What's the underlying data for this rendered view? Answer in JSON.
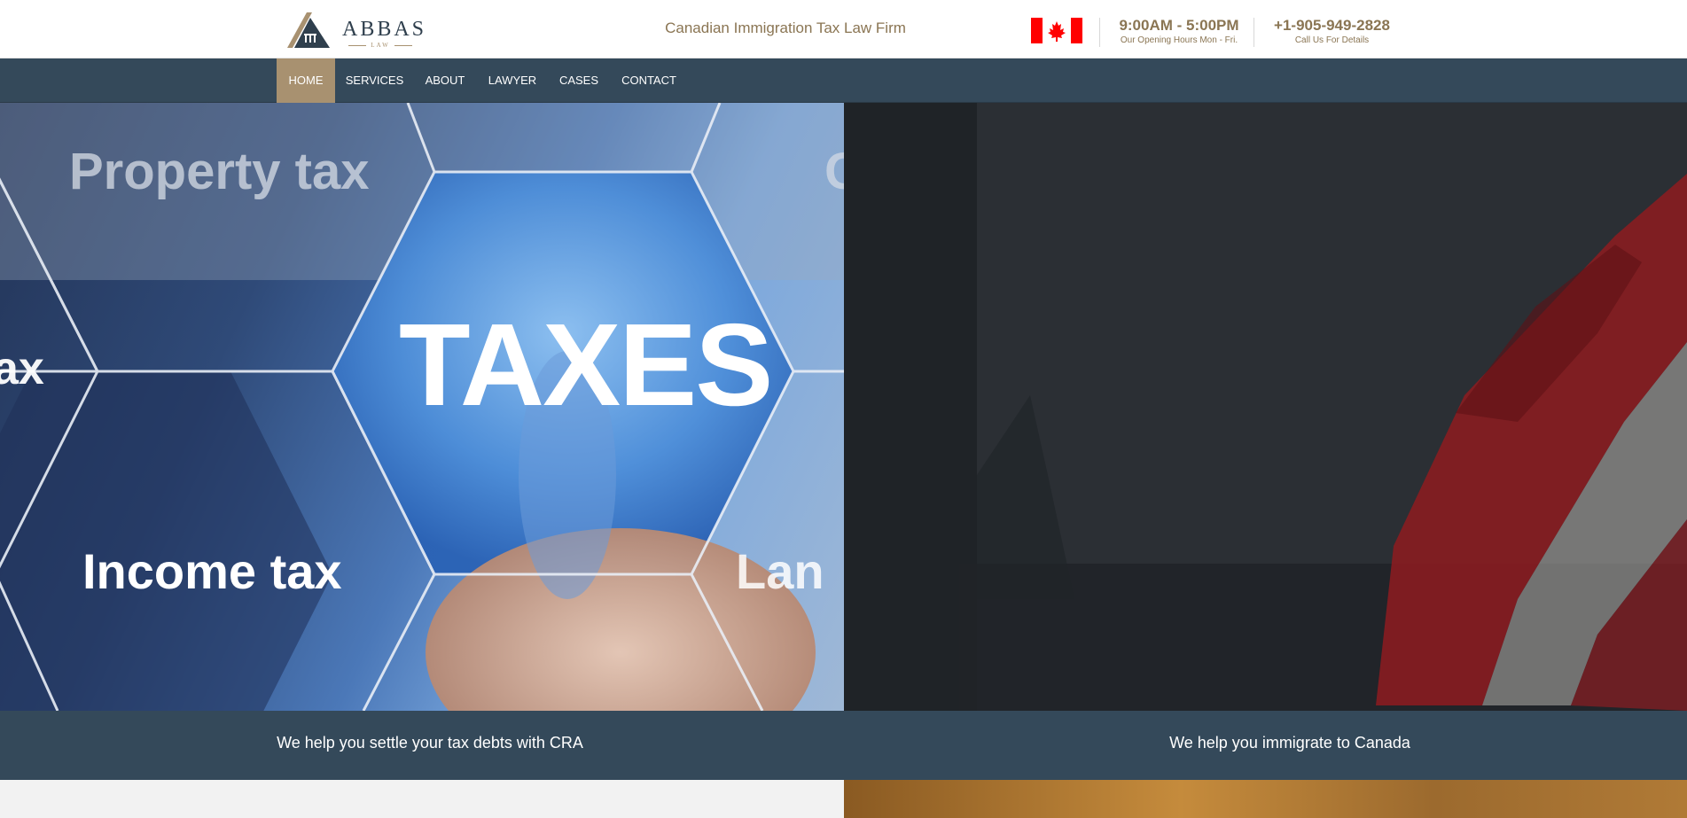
{
  "header": {
    "logo": {
      "name": "ABBAS",
      "sub": "LAW"
    },
    "tagline": "Canadian Immigration Tax Law Firm",
    "hours": {
      "main": "9:00AM - 5:00PM",
      "sub": "Our Opening Hours Mon - Fri."
    },
    "phone": {
      "main": "+1-905-949-2828",
      "sub": "Call Us For Details"
    }
  },
  "nav": {
    "items": [
      {
        "label": "HOME",
        "active": true
      },
      {
        "label": "SERVICES",
        "active": false
      },
      {
        "label": "ABOUT",
        "active": false
      },
      {
        "label": "LAWYER",
        "active": false
      },
      {
        "label": "CASES",
        "active": false
      },
      {
        "label": "CONTACT",
        "active": false
      }
    ]
  },
  "hero": {
    "left": {
      "image_words": {
        "property": "Property tax",
        "taxes": "TAXES",
        "income": "Income tax",
        "partial_left": "ax",
        "partial_right": "Lan",
        "partial_top": "C"
      },
      "caption": "We help you settle your tax debts with CRA"
    },
    "right": {
      "caption": "We help you immigrate to Canada"
    }
  },
  "colors": {
    "brand_gold": "#a89170",
    "nav_bg": "#34495a",
    "text_gold": "#8a7553",
    "flag_red": "#ff0000"
  }
}
